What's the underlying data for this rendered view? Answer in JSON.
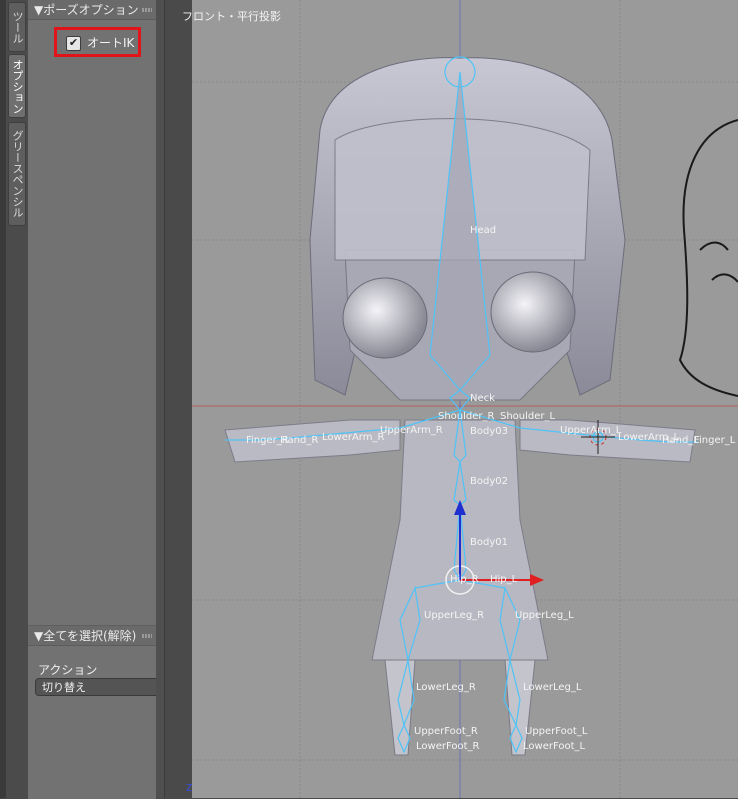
{
  "tabs": [
    {
      "label": "ツール",
      "active": false
    },
    {
      "label": "オプション",
      "active": true
    },
    {
      "label": "グリースペンシル",
      "active": false
    }
  ],
  "pose_options_panel": {
    "title": "▼ポーズオプション",
    "auto_ik": {
      "label": "オートIK",
      "checked": true
    }
  },
  "select_all_panel": {
    "title": "▼全てを選択(解除)",
    "action_label": "アクション",
    "action_value": "切り替え"
  },
  "viewport": {
    "title": "フロント・平行投影",
    "axis_label": "z"
  },
  "bones": [
    "Head",
    "Neck",
    "Shoulder_R",
    "Shoulder_L",
    "Body03",
    "Body02",
    "Body01",
    "UpperArm_R",
    "LowerArm_R",
    "Hand_R",
    "Finger_R",
    "UpperArm_L",
    "LowerArm_L",
    "Hand_L",
    "Finger_L",
    "Hip_R",
    "Hip_L",
    "UpperLeg_R",
    "UpperLeg_L",
    "LowerLeg_R",
    "LowerLeg_L",
    "UpperFoot_R",
    "UpperFoot_L",
    "LowerFoot_R",
    "LowerFoot_L"
  ],
  "colors": {
    "bone": "#4fc3f7",
    "highlight_box": "#e1141a",
    "x_axis": "#e02020",
    "z_axis": "#2030d0"
  }
}
